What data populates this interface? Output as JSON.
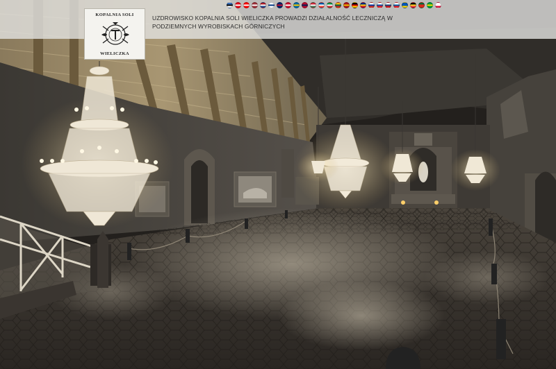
{
  "logo": {
    "top_text": "KOPALNIA SOLI",
    "bottom_text": "WIELICZKA"
  },
  "announcement": "UZDROWISKO KOPALNIA SOLI WIELICZKA PROWADZI DZIAŁALNOŚĆ LECZNICZĄ W PODZIEMNYCH WYROBISKACH GÓRNICZYCH",
  "language_flags": [
    {
      "code": "ee",
      "icon": "flag-estonia-icon",
      "colors": [
        "#3a75c4",
        "#000000",
        "#ffffff"
      ]
    },
    {
      "code": "tr",
      "icon": "flag-turkey-icon",
      "colors": [
        "#e30a17",
        "#ffffff",
        "#e30a17"
      ]
    },
    {
      "code": "ca",
      "icon": "flag-canada-icon",
      "colors": [
        "#ff0000",
        "#ffffff",
        "#ff0000"
      ]
    },
    {
      "code": "lv",
      "icon": "flag-latvia-icon",
      "colors": [
        "#9e3039",
        "#ffffff",
        "#9e3039"
      ]
    },
    {
      "code": "nl",
      "icon": "flag-netherlands-icon",
      "colors": [
        "#ae1c28",
        "#ffffff",
        "#21468b"
      ]
    },
    {
      "code": "fi",
      "icon": "flag-finland-icon",
      "colors": [
        "#ffffff",
        "#003580",
        "#ffffff"
      ]
    },
    {
      "code": "gb",
      "icon": "flag-uk-icon",
      "colors": [
        "#012169",
        "#c8102e",
        "#012169"
      ]
    },
    {
      "code": "dk",
      "icon": "flag-denmark-icon",
      "colors": [
        "#c8102e",
        "#ffffff",
        "#c8102e"
      ]
    },
    {
      "code": "se",
      "icon": "flag-sweden-icon",
      "colors": [
        "#006aa7",
        "#fecc00",
        "#006aa7"
      ]
    },
    {
      "code": "no",
      "icon": "flag-norway-icon",
      "colors": [
        "#ba0c2f",
        "#00205b",
        "#ba0c2f"
      ]
    },
    {
      "code": "hu",
      "icon": "flag-hungary-icon",
      "colors": [
        "#ce2939",
        "#ffffff",
        "#477050"
      ]
    },
    {
      "code": "fr",
      "icon": "flag-france-icon",
      "colors": [
        "#0055a4",
        "#ffffff",
        "#ef4135"
      ]
    },
    {
      "code": "it",
      "icon": "flag-italy-icon",
      "colors": [
        "#009246",
        "#ffffff",
        "#ce2b37"
      ]
    },
    {
      "code": "lt",
      "icon": "flag-lithuania-icon",
      "colors": [
        "#fdb913",
        "#006a44",
        "#c1272d"
      ]
    },
    {
      "code": "es",
      "icon": "flag-spain-icon",
      "colors": [
        "#aa151b",
        "#f1bf00",
        "#aa151b"
      ]
    },
    {
      "code": "de",
      "icon": "flag-germany-icon",
      "colors": [
        "#000000",
        "#dd0000",
        "#ffce00"
      ]
    },
    {
      "code": "ro",
      "icon": "flag-romania-icon",
      "colors": [
        "#002b7f",
        "#fcd116",
        "#ce1126"
      ]
    },
    {
      "code": "ru",
      "icon": "flag-russia-icon",
      "colors": [
        "#ffffff",
        "#0039a6",
        "#d52b1e"
      ]
    },
    {
      "code": "sk",
      "icon": "flag-slovakia-icon",
      "colors": [
        "#ffffff",
        "#0b4ea2",
        "#ee1c25"
      ]
    },
    {
      "code": "cz",
      "icon": "flag-czech-icon",
      "colors": [
        "#ffffff",
        "#11457e",
        "#d7141a"
      ]
    },
    {
      "code": "si",
      "icon": "flag-slovenia-icon",
      "colors": [
        "#ffffff",
        "#005da4",
        "#ed1c24"
      ]
    },
    {
      "code": "ua",
      "icon": "flag-ukraine-icon",
      "colors": [
        "#0057b7",
        "#0057b7",
        "#ffd700"
      ]
    },
    {
      "code": "be",
      "icon": "flag-belgium-icon",
      "colors": [
        "#000000",
        "#fdda24",
        "#ef3340"
      ]
    },
    {
      "code": "pt",
      "icon": "flag-portugal-icon",
      "colors": [
        "#046a38",
        "#da291c",
        "#da291c"
      ]
    },
    {
      "code": "br",
      "icon": "flag-brazil-icon",
      "colors": [
        "#009c3b",
        "#ffdf00",
        "#009c3b"
      ]
    },
    {
      "code": "pl",
      "icon": "flag-poland-icon",
      "colors": [
        "#ffffff",
        "#ffffff",
        "#dc143c"
      ]
    }
  ]
}
